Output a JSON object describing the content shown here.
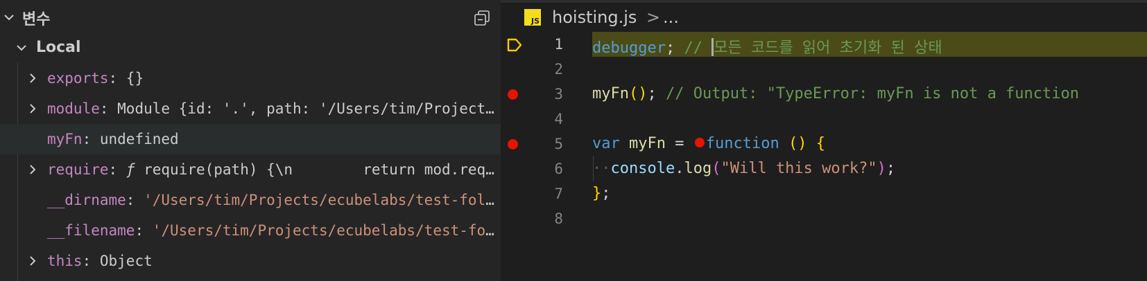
{
  "variables_panel": {
    "title": "변수",
    "scope": "Local",
    "rows": [
      {
        "name": "exports",
        "value": "{}",
        "expandable": true
      },
      {
        "name": "module",
        "value": "Module {id: '.', path: '/Users/tim/Projects/ecubelabs/test-f...",
        "expandable": true
      },
      {
        "name": "myFn",
        "value": "undefined",
        "expandable": false,
        "selected": true
      },
      {
        "name": "require",
        "value_prefix": "ƒ",
        "value": "require(path) {\\n        return mod.require(path);",
        "expandable": true
      },
      {
        "name": "__dirname",
        "value": "'/Users/tim/Projects/ecubelabs/test-folder'",
        "expandable": false,
        "string": true
      },
      {
        "name": "__filename",
        "value": "'/Users/tim/Projects/ecubelabs/test-folder/hoisting.js'",
        "expandable": false,
        "string": true
      },
      {
        "name": "this",
        "value": "Object",
        "expandable": true
      }
    ],
    "icons": {
      "collapse": "collapse-all-icon",
      "chevron": "chevron-icon"
    }
  },
  "editor": {
    "breadcrumb": {
      "file": "hoisting.js",
      "separator": ">",
      "more": "...",
      "file_icon_label": "JS"
    },
    "lines": [
      {
        "number": "1",
        "tokens": [
          [
            "k",
            "debugger"
          ],
          [
            "o",
            "; "
          ],
          [
            "c",
            "// "
          ],
          [
            "cursor",
            ""
          ],
          [
            "c",
            "모든 코드를 읽어 초기화 된 상태"
          ]
        ]
      },
      {
        "number": "2",
        "tokens": []
      },
      {
        "number": "3",
        "tokens": [
          [
            "f",
            "myFn"
          ],
          [
            "p",
            "()"
          ],
          [
            "o",
            "; "
          ],
          [
            "c",
            "// Output: \"TypeError: myFn is not a function"
          ]
        ]
      },
      {
        "number": "4",
        "tokens": []
      },
      {
        "number": "5",
        "tokens": [
          [
            "k",
            "var"
          ],
          [
            "o",
            " "
          ],
          [
            "f",
            "myFn"
          ],
          [
            "o",
            " = "
          ],
          [
            "bp",
            ""
          ],
          [
            "k",
            "function"
          ],
          [
            "o",
            " "
          ],
          [
            "p",
            "()"
          ],
          [
            "o",
            " "
          ],
          [
            "p",
            "{"
          ]
        ]
      },
      {
        "number": "6",
        "tokens": [
          [
            "ws",
            "··"
          ],
          [
            "v",
            "console"
          ],
          [
            "o",
            "."
          ],
          [
            "f",
            "log"
          ],
          [
            "p2",
            "("
          ],
          [
            "s",
            "\"Will this work?\""
          ],
          [
            "p2",
            ")"
          ],
          [
            "o",
            ";"
          ]
        ]
      },
      {
        "number": "7",
        "tokens": [
          [
            "p",
            "}"
          ],
          [
            "o",
            ";"
          ]
        ]
      },
      {
        "number": "8",
        "tokens": []
      }
    ],
    "paused_line": "1",
    "breakpoint_lines": [
      "3",
      "5"
    ]
  }
}
